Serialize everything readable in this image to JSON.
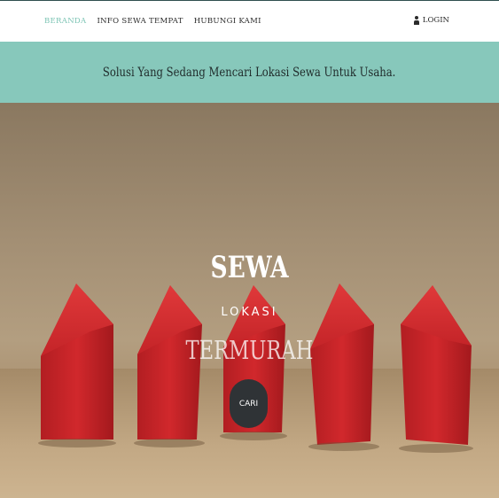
{
  "nav": {
    "links": [
      "BERANDA",
      "INFO SEWA TEMPAT",
      "HUBUNGI KAMI"
    ],
    "login_label": "LOGIN",
    "active_color": "#7cc4b4"
  },
  "banner": {
    "text": "Solusi Yang Sedang Mencari Lokasi Sewa Untuk Usaha.",
    "background": "#87c8bb"
  },
  "hero": {
    "title": "SEWA",
    "subtitle": "LOKASI",
    "tagline": "TERMURAH",
    "button_label": "CARI"
  },
  "icons": {
    "login": "user-icon"
  }
}
